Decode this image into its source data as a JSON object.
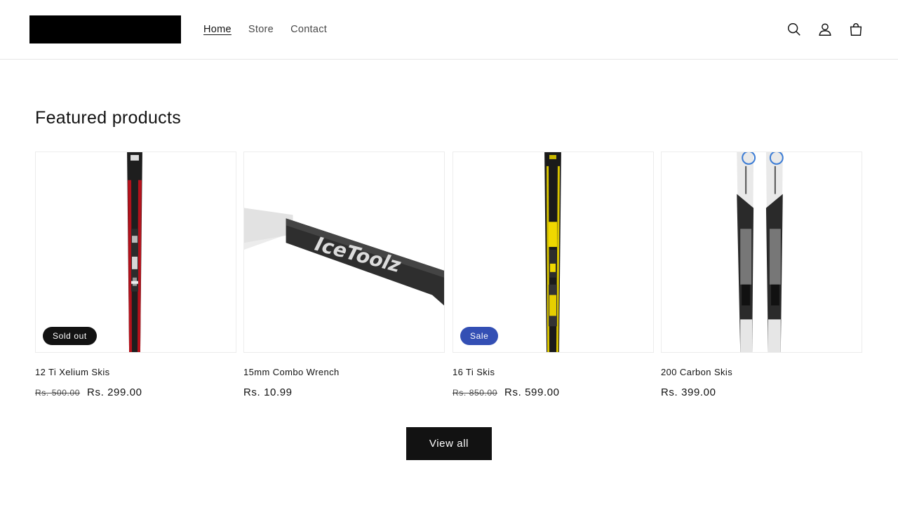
{
  "header": {
    "nav": [
      {
        "label": "Home",
        "active": true
      },
      {
        "label": "Store",
        "active": false
      },
      {
        "label": "Contact",
        "active": false
      }
    ],
    "icons": [
      "search-icon",
      "account-icon",
      "cart-icon"
    ]
  },
  "section": {
    "title": "Featured products"
  },
  "products": [
    {
      "title": "12 Ti Xelium Skis",
      "badge": "Sold out",
      "old_price": "Rs. 500.00",
      "price": "Rs. 299.00",
      "image": "red-black-ski"
    },
    {
      "title": "15mm Combo Wrench",
      "badge": "",
      "old_price": "",
      "price": "Rs. 10.99",
      "image": "icetoolz-wrench",
      "image_text": "IceToolz"
    },
    {
      "title": "16 Ti Skis",
      "badge": "Sale",
      "old_price": "Rs. 850.00",
      "price": "Rs. 599.00",
      "image": "yellow-black-ski"
    },
    {
      "title": "200 Carbon Skis",
      "badge": "",
      "old_price": "",
      "price": "Rs. 399.00",
      "image": "white-skis-pair"
    }
  ],
  "view_all_label": "View all",
  "colors": {
    "sale_badge": "#334fb4",
    "soldout_badge": "#121212",
    "button": "#121212"
  }
}
